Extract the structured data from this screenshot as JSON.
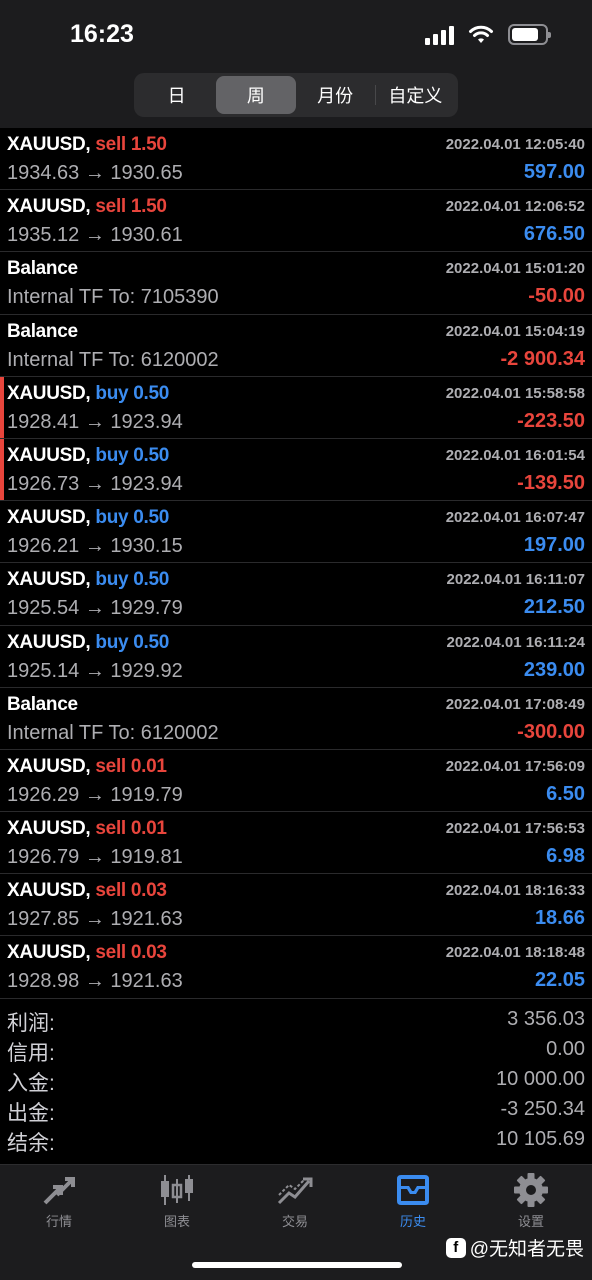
{
  "status_bar": {
    "time": "16:23"
  },
  "period_tabs": [
    {
      "label": "日",
      "active": false
    },
    {
      "label": "周",
      "active": true
    },
    {
      "label": "月份",
      "active": false
    },
    {
      "label": "自定义",
      "active": false
    }
  ],
  "deals": [
    {
      "symbol": "XAUUSD,",
      "action": "sell 1.50",
      "type": "sell",
      "time": "2022.04.01 12:05:40",
      "sub": "1934.63 → 1930.65",
      "profit": "597.00",
      "sign": "pos",
      "marked": false
    },
    {
      "symbol": "XAUUSD,",
      "action": "sell 1.50",
      "type": "sell",
      "time": "2022.04.01 12:06:52",
      "sub": "1935.12 → 1930.61",
      "profit": "676.50",
      "sign": "pos",
      "marked": false
    },
    {
      "symbol": "Balance",
      "action": "",
      "type": "balance",
      "time": "2022.04.01 15:01:20",
      "sub": "Internal TF To: 7105390",
      "profit": "-50.00",
      "sign": "neg",
      "marked": false
    },
    {
      "symbol": "Balance",
      "action": "",
      "type": "balance",
      "time": "2022.04.01 15:04:19",
      "sub": "Internal TF To: 6120002",
      "profit": "-2 900.34",
      "sign": "neg",
      "marked": false
    },
    {
      "symbol": "XAUUSD,",
      "action": "buy 0.50",
      "type": "buy",
      "time": "2022.04.01 15:58:58",
      "sub": "1928.41 → 1923.94",
      "profit": "-223.50",
      "sign": "neg",
      "marked": true
    },
    {
      "symbol": "XAUUSD,",
      "action": "buy 0.50",
      "type": "buy",
      "time": "2022.04.01 16:01:54",
      "sub": "1926.73 → 1923.94",
      "profit": "-139.50",
      "sign": "neg",
      "marked": true
    },
    {
      "symbol": "XAUUSD,",
      "action": "buy 0.50",
      "type": "buy",
      "time": "2022.04.01 16:07:47",
      "sub": "1926.21 → 1930.15",
      "profit": "197.00",
      "sign": "pos",
      "marked": false
    },
    {
      "symbol": "XAUUSD,",
      "action": "buy 0.50",
      "type": "buy",
      "time": "2022.04.01 16:11:07",
      "sub": "1925.54 → 1929.79",
      "profit": "212.50",
      "sign": "pos",
      "marked": false
    },
    {
      "symbol": "XAUUSD,",
      "action": "buy 0.50",
      "type": "buy",
      "time": "2022.04.01 16:11:24",
      "sub": "1925.14 → 1929.92",
      "profit": "239.00",
      "sign": "pos",
      "marked": false
    },
    {
      "symbol": "Balance",
      "action": "",
      "type": "balance",
      "time": "2022.04.01 17:08:49",
      "sub": "Internal TF To: 6120002",
      "profit": "-300.00",
      "sign": "neg",
      "marked": false
    },
    {
      "symbol": "XAUUSD,",
      "action": "sell 0.01",
      "type": "sell",
      "time": "2022.04.01 17:56:09",
      "sub": "1926.29 → 1919.79",
      "profit": "6.50",
      "sign": "pos",
      "marked": false
    },
    {
      "symbol": "XAUUSD,",
      "action": "sell 0.01",
      "type": "sell",
      "time": "2022.04.01 17:56:53",
      "sub": "1926.79 → 1919.81",
      "profit": "6.98",
      "sign": "pos",
      "marked": false
    },
    {
      "symbol": "XAUUSD,",
      "action": "sell 0.03",
      "type": "sell",
      "time": "2022.04.01 18:16:33",
      "sub": "1927.85 → 1921.63",
      "profit": "18.66",
      "sign": "pos",
      "marked": false
    },
    {
      "symbol": "XAUUSD,",
      "action": "sell 0.03",
      "type": "sell",
      "time": "2022.04.01 18:18:48",
      "sub": "1928.98 → 1921.63",
      "profit": "22.05",
      "sign": "pos",
      "marked": false
    }
  ],
  "summary": [
    {
      "label": "利润:",
      "value": "3 356.03"
    },
    {
      "label": "信用:",
      "value": "0.00"
    },
    {
      "label": "入金:",
      "value": "10 000.00"
    },
    {
      "label": "出金:",
      "value": "-3 250.34"
    },
    {
      "label": "结余:",
      "value": "10 105.69"
    }
  ],
  "tabbar": [
    {
      "label": "行情",
      "icon": "quotes-arrows-icon",
      "active": false
    },
    {
      "label": "图表",
      "icon": "candlestick-chart-icon",
      "active": false
    },
    {
      "label": "交易",
      "icon": "trade-trend-icon",
      "active": false
    },
    {
      "label": "历史",
      "icon": "history-inbox-icon",
      "active": true
    },
    {
      "label": "设置",
      "icon": "gear-icon",
      "active": false
    }
  ],
  "watermark": {
    "logo": "f",
    "text": "@无知者无畏"
  },
  "colors": {
    "sell": "#e8453c",
    "buy": "#3b8cf0",
    "profit_positive": "#3b8cf0",
    "profit_negative": "#e8453c",
    "background": "#000000"
  }
}
